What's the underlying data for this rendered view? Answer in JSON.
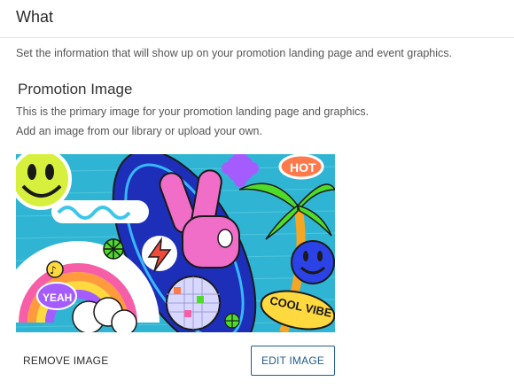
{
  "section": {
    "title": "What",
    "description": "Set the information that will show up on your promotion landing page and event graphics."
  },
  "promotion_image": {
    "title": "Promotion Image",
    "line1": "This is the primary image for your promotion landing page and graphics.",
    "line2": "Add an image from our library or upload your own.",
    "image_texts": {
      "hot": "HOT",
      "yeah": "YEAH",
      "cool_vibe": "COOL VIBE"
    }
  },
  "actions": {
    "remove_label": "REMOVE IMAGE",
    "edit_label": "EDIT IMAGE"
  },
  "colors": {
    "accent": "#1f5c8f",
    "divider": "#e2e2e2",
    "image_background": "#2fb5d3"
  }
}
